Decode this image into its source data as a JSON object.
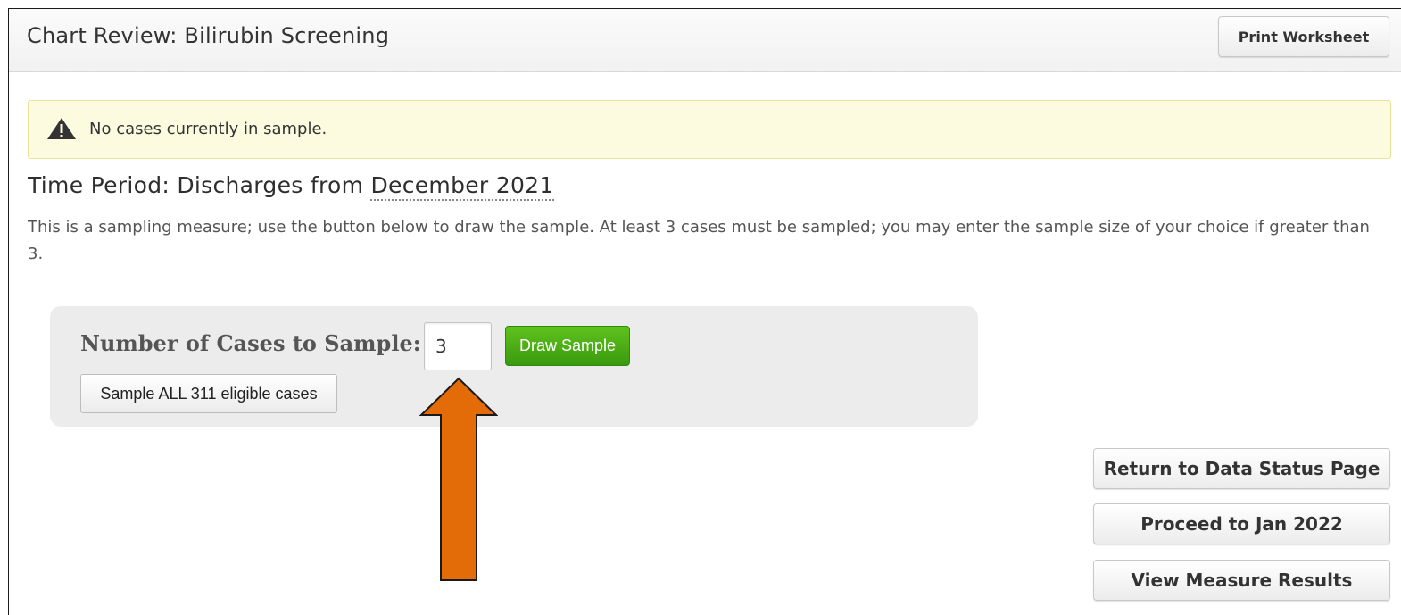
{
  "header": {
    "title": "Chart Review:  Bilirubin Screening",
    "print_button_label": "Print Worksheet"
  },
  "alert": {
    "icon": "warning-icon",
    "message": "No cases currently in sample."
  },
  "time_period": {
    "prefix": "Time Period: Discharges from ",
    "month": "December 2021"
  },
  "description": "This is a sampling measure; use the button below to draw the sample. At least 3 cases must be sampled; you may enter the sample size of your choice if greater than 3.",
  "sampling": {
    "label": "Number of Cases to Sample:",
    "input_value": "3",
    "draw_button_label": "Draw Sample",
    "sample_all_label": "Sample ALL 311 eligible cases"
  },
  "annotation": {
    "icon": "up-arrow-icon",
    "color": "#e36c09"
  },
  "navigation": {
    "return_label": "Return to Data Status Page",
    "proceed_label": "Proceed to Jan 2022",
    "results_label": "View Measure Results"
  },
  "colors": {
    "draw_button": "#4aab14",
    "alert_background": "#fcfbe0",
    "arrow": "#e36c09"
  }
}
